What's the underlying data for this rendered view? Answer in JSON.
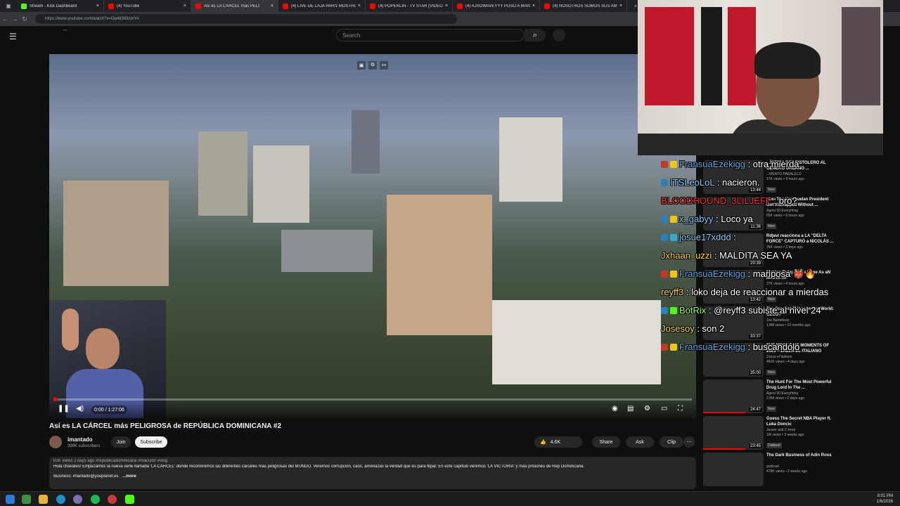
{
  "browser": {
    "tabs": [
      {
        "title": "Stream - Kick Dashboard",
        "color": "#53fc18"
      },
      {
        "title": "(4) YouTube",
        "color": "#ff0000"
      },
      {
        "title": "Así es LA CÁRCEL más PELI",
        "color": "#ff0000"
      },
      {
        "title": "(4) LIVE DE LAJA PAR/1 MOSTRO",
        "color": "#ff0000"
      },
      {
        "title": "(4) POPERLIN - TV STAR (VIDEO",
        "color": "#ff0000"
      },
      {
        "title": "(4) AJSOWAVEYYY PUSO A MAN",
        "color": "#ff0000"
      },
      {
        "title": "(4) NOSOTROS SOMOS SUS AMI",
        "color": "#ff0000"
      }
    ],
    "new_tab": "+",
    "url": "https://www.youtube.com/watch?v=Op48368zmYA"
  },
  "youtube": {
    "search_placeholder": "Search",
    "player": {
      "time": "0:00 / 1:27:06"
    },
    "video_title": "Así es LA CÁRCEL más PELIGROSA de REPÚBLICA DOMINICANA #2",
    "channel": {
      "name": "imantado",
      "subs": "399K subscribers"
    },
    "buttons": {
      "join": "Join",
      "subscribe": "Subscribe",
      "likes": "4.6K",
      "share": "Share",
      "ask": "Ask",
      "clip": "Clip"
    },
    "description": {
      "meta": "61K views  2 days ago  #republicadominicana #reacción #vlog",
      "text": "Hola chavales! Empezamos la nueva serie llamada 'LA CÁRCEL' dónde recorreremos las diferentes cárceles más peligrosas del MUNDO. Veremos corrupción, caos, amenazas la verdad que es para flipar. En este capítulo veremos 'LA VICTORIA' y más prisiones de Rep Dominicana.",
      "business": "Business: imantado@youplanet.es",
      "more": "...more"
    },
    "recommendations": [
      {
        "title": "...ÍCTIMA DEL PISTOLERO AL GÉNERO URBANO ...",
        "channel": "...MENTO PARALELO",
        "stats": "17K views • 9 hours ago",
        "badge": "New",
        "duration": "13:44"
      },
      {
        "title": "How The Venezuelan President Got Kidnapped Without ...",
        "channel": "Agent 00 Everything",
        "stats": "65K views • 6 hours ago",
        "badge": "New",
        "duration": "11:36"
      },
      {
        "title": "Rdjavi reacciona a LA \"DELTA FORCE\" CAPTURÓ a NICOLÁS ...",
        "channel": "",
        "stats": "35K views • 2 days ago",
        "badge": "",
        "duration": "29:39"
      },
      {
        "title": "Making Roleplayers Rage As aN IN GTA RP",
        "channel": "",
        "stats": "37K views • 4 hours ago",
        "badge": "New",
        "duration": "13:42"
      },
      {
        "title": "The Scariest Prison In The World: CECOT",
        "channel": "Joe Bamelozzi",
        "stats": "1.8M views • 10 months ago",
        "badge": "",
        "duration": "33:37"
      },
      {
        "title": "THE MOST EPIC MOMENTS OF 2025 – ZAZZA EL ITALIANO",
        "channel": "Zazza el Italiano",
        "stats": "461K views • 4 days ago",
        "badge": "New",
        "duration": "35:00"
      },
      {
        "title": "The Hunt For The Most Powerful Drug Lord In The ...",
        "channel": "Agent 00 Everything",
        "stats": "2.8M views • 2 days ago",
        "badge": "New",
        "duration": "24:47"
      },
      {
        "title": "Guess The Secret NBA Player ft. Luka Doncic",
        "channel": "Jesser and 2 more",
        "stats": "1M views • 3 weeks ago",
        "badge": "Dubbed",
        "duration": "23:45"
      },
      {
        "title": "The Dark Business of Adin Ross",
        "channel": "goldcart",
        "stats": "478K views • 2 weeks ago",
        "badge": "",
        "duration": ""
      }
    ]
  },
  "chat": [
    {
      "user": "FransuaEzekigg",
      "text": " : otra mierda",
      "color": "#5fa9e6",
      "icons": [
        "#c0392b",
        "#f1c40f"
      ]
    },
    {
      "user": "ITSLeoLoL",
      "text": " : nacieron.",
      "color": "#7fd3ff",
      "icons": [
        "#2c7fb8"
      ]
    },
    {
      "user": "BLOODHOUND_3LILJEFF",
      "text": " : bro?",
      "color": "#ff3030",
      "icons": []
    },
    {
      "user": "x_gabyy",
      "text": " : Loco ya",
      "color": "#80d0ff",
      "icons": [
        "#2c7fb8",
        "#f1c40f"
      ]
    },
    {
      "user": "josue17xddd",
      "text": " :",
      "color": "#80d0ff",
      "icons": [
        "#2c7fb8",
        "#3ac"
      ]
    },
    {
      "user": "Jxhaan_uzzi",
      "text": " : MALDITA SEA YA",
      "color": "#ffd84d",
      "icons": []
    },
    {
      "user": "FransuaEzekigg",
      "text": " : mariposa 👹🔥",
      "color": "#5fa9e6",
      "icons": [
        "#c0392b",
        "#f1c40f"
      ]
    },
    {
      "user": "reyff3",
      "text": " : loko deja de reaccionar a mierdas",
      "color": "#ffd84d",
      "icons": []
    },
    {
      "user": "BotRix",
      "text": " : @reyff3 subiste al nivel 24",
      "color": "#9cff5a",
      "icons": [
        "#2c7fb8",
        "#53fc18"
      ]
    },
    {
      "user": "Josesoy",
      "text": " : son 2",
      "color": "#ffd84d",
      "icons": []
    },
    {
      "user": "FransuaEzekigg",
      "text": " : buscandolo",
      "color": "#5fa9e6",
      "icons": [
        "#c0392b",
        "#f1c40f"
      ]
    }
  ],
  "taskbar": {
    "time": "8:01 PM",
    "date": "1/6/2026"
  }
}
